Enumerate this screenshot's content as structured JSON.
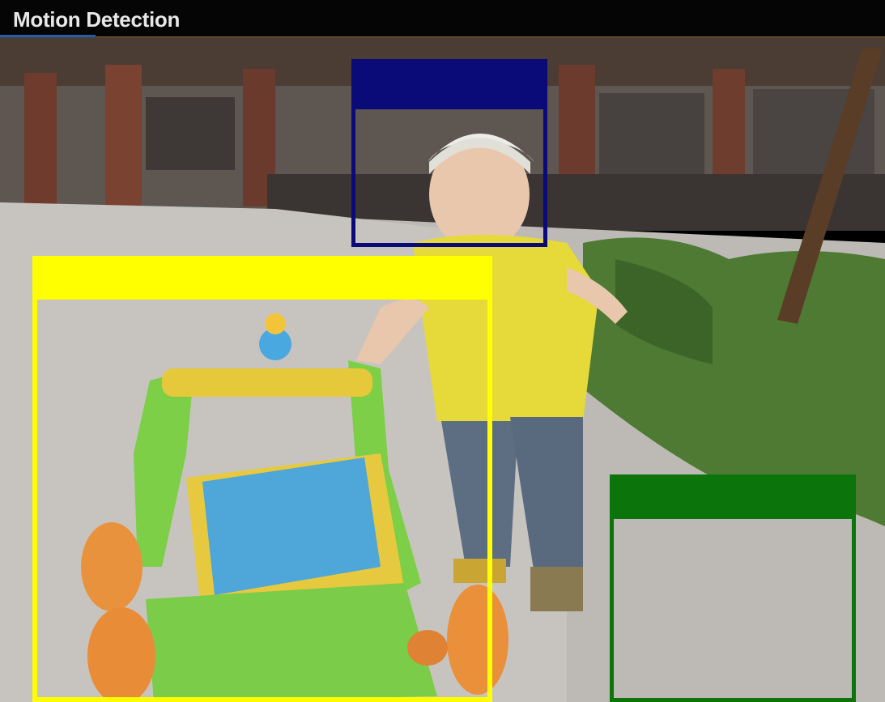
{
  "window": {
    "title": "Motion Detection"
  },
  "colors": {
    "title_bar": "#050505",
    "title_text": "#e8e8e8",
    "title_accent": "#1e5fa8",
    "zone_1": "#0a0a78",
    "zone_2": "#ffff00",
    "zone_3": "#0b740b"
  },
  "zones": [
    {
      "id": "zone-1",
      "color_name": "navy"
    },
    {
      "id": "zone-2",
      "color_name": "yellow"
    },
    {
      "id": "zone-3",
      "color_name": "green"
    }
  ]
}
